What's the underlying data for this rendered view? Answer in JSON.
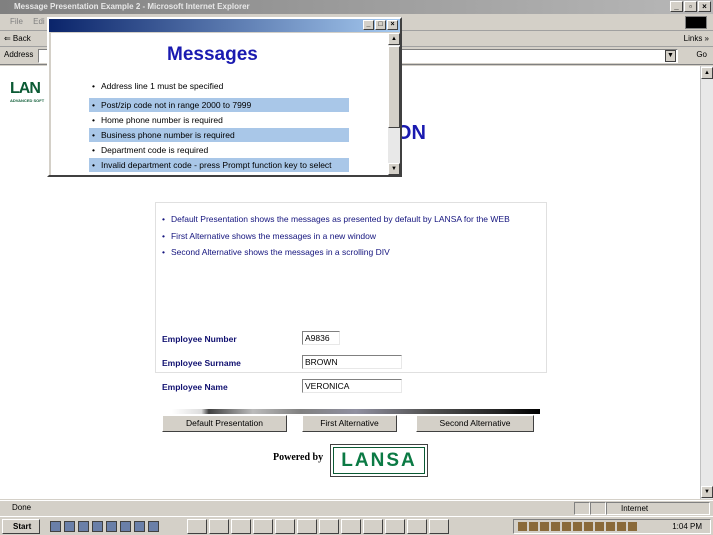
{
  "window": {
    "title": "Message Presentation Example 2 - Microsoft Internet Explorer"
  },
  "menu": {
    "items": [
      "File",
      "Edi"
    ]
  },
  "toolbar": {
    "back": "⇐ Back",
    "links": "Links »"
  },
  "address": {
    "label": "Address",
    "go": "Go"
  },
  "page": {
    "logo_big": "LAN",
    "logo_small": "ADVANCED SOFT",
    "heading": "NTATION",
    "bullets": [
      "Default Presentation shows the messages as presented by default by LANSA for the WEB",
      "First Alternative shows the messages in a new window",
      "Second Alternative shows the messages in a scrolling DIV"
    ],
    "fields": [
      {
        "label": "Employee Number",
        "value": "A9836"
      },
      {
        "label": "Employee Surname",
        "value": "BROWN"
      },
      {
        "label": "Employee Name",
        "value": "VERONICA"
      }
    ],
    "buttons": [
      "Default Presentation",
      "First Alternative",
      "Second Alternative"
    ],
    "powered_by": "Powered by",
    "lansa_logo": "LANSA"
  },
  "popup": {
    "heading": "Messages",
    "messages": [
      {
        "text": "Address line 1 must be specified",
        "highlight": false
      },
      {
        "text": "Post/zip code not in range 2000 to 7999",
        "highlight": true
      },
      {
        "text": "Home phone number is required",
        "highlight": false
      },
      {
        "text": "Business phone number is required",
        "highlight": true
      },
      {
        "text": "Department code is required",
        "highlight": false
      },
      {
        "text": "Invalid department code - press Prompt function key to select",
        "highlight": true
      }
    ]
  },
  "status": {
    "text": "Done",
    "zone": "Internet"
  },
  "taskbar": {
    "start": "Start",
    "clock": "1:04 PM"
  },
  "colors": {
    "heading": "#1a1ab0",
    "highlight": "#a9c7e8",
    "lansa_green": "#0b7a44"
  }
}
